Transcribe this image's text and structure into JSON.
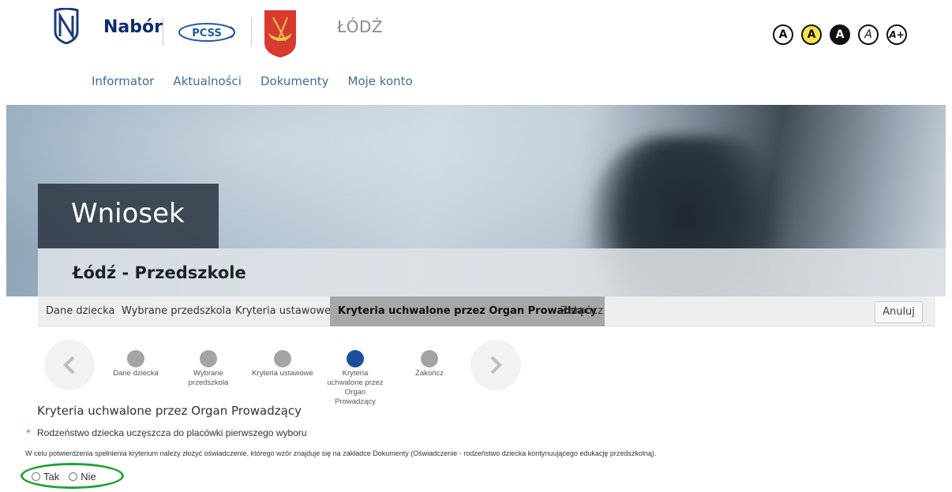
{
  "header": {
    "brand": "Nabór",
    "partner_logo_text": "PCSS",
    "city": "ŁÓDŹ",
    "accessibility": [
      "A",
      "A",
      "A",
      "A",
      "A+"
    ],
    "colors": {
      "brand": "#0c2c6b",
      "nav": "#3f6c9e",
      "a11y_yellow": "#f5e54b"
    }
  },
  "nav": {
    "items": [
      "Informator",
      "Aktualności",
      "Dokumenty",
      "Moje konto"
    ]
  },
  "banner": {
    "title": "Wniosek",
    "subtitle": "Łódź - Przedszkole"
  },
  "tabs": {
    "items": [
      "Dane dziecka",
      "Wybrane przedszkola",
      "Kryteria ustawowe",
      "Kryteria uchwalone przez Organ Prowadzący",
      "Zakończ"
    ],
    "active_index": 3,
    "cancel_label": "Anuluj"
  },
  "stepper": {
    "prev_icon": "chevron-left-icon",
    "next_icon": "chevron-right-icon",
    "steps": [
      "Dane dziecka",
      "Wybrane przedszkola",
      "Kryteria ustawowe",
      "Kryteria uchwalone przez Organ Prowadzący",
      "Zakończ"
    ],
    "active_index": 3,
    "colors": {
      "active": "#1a4fa0",
      "inactive": "#a4a4a4"
    }
  },
  "content": {
    "section_title": "Kryteria uchwalone przez Organ Prowadzący",
    "required_mark": "*",
    "criterion": "Rodzeństwo dziecka uczęszcza do placówki pierwszego wyboru",
    "info": "W celu potwierdzenia spełnienia kryterium należy złożyć oświadczenie, którego wzór znajduje się na zakładce Dokumenty (Oświadczenie - rodzeństwo dziecka kontynuującego edukację przedszkolną).",
    "options": [
      "Tak",
      "Nie"
    ]
  }
}
